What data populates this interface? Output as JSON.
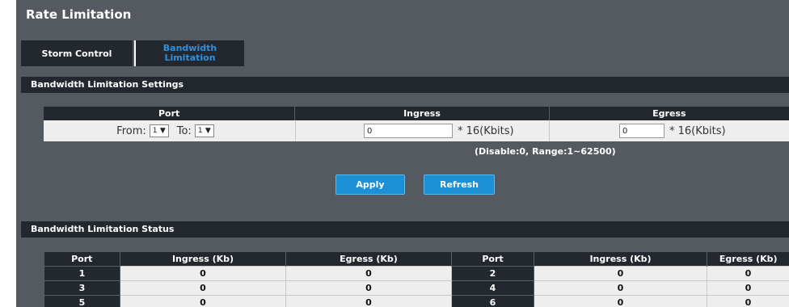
{
  "page": {
    "title": "Rate Limitation"
  },
  "tabs": [
    {
      "label": "Storm Control",
      "active": false
    },
    {
      "label": "Bandwidth Limitation",
      "active": true
    }
  ],
  "settings": {
    "section_title": "Bandwidth Limitation Settings",
    "headers": {
      "port": "Port",
      "ingress": "Ingress",
      "egress": "Egress"
    },
    "from_label": "From:",
    "from_value": "1",
    "to_label": "To:",
    "to_value": "1",
    "ingress_value": "0",
    "ingress_unit": "* 16(Kbits)",
    "egress_value": "0",
    "egress_unit": "* 16(Kbits)",
    "range_note": "(Disable:0, Range:1~62500)",
    "apply_label": "Apply",
    "refresh_label": "Refresh"
  },
  "status": {
    "section_title": "Bandwidth Limitation Status",
    "headers": [
      "Port",
      "Ingress (Kb)",
      "Egress (Kb)",
      "Port",
      "Ingress (Kb)",
      "Egress (Kb)"
    ],
    "rows": [
      [
        "1",
        "0",
        "0",
        "2",
        "0",
        "0"
      ],
      [
        "3",
        "0",
        "0",
        "4",
        "0",
        "0"
      ],
      [
        "5",
        "0",
        "0",
        "6",
        "0",
        "0"
      ]
    ]
  },
  "colors": {
    "background": "#555a60",
    "bar": "#23282e",
    "accent": "#1c8fd6",
    "active_tab_text": "#2f8fe0"
  }
}
